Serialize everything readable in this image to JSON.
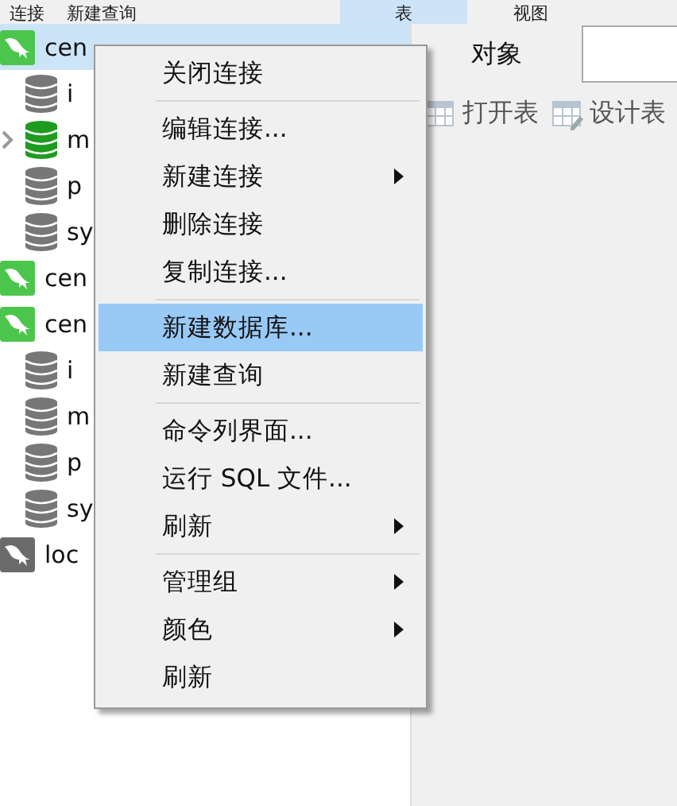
{
  "toolbar": [
    {
      "label": "连接"
    },
    {
      "label": "新建查询"
    }
  ],
  "view_tabs": [
    {
      "label": "表",
      "selected": true
    },
    {
      "label": "视图",
      "selected": false
    }
  ],
  "tree": [
    {
      "kind": "connection",
      "label": "cen",
      "selected": true,
      "active": true,
      "children": [
        {
          "kind": "database",
          "label": "i",
          "active": false,
          "expandable": false
        },
        {
          "kind": "database",
          "label": "m",
          "active": true,
          "expandable": true
        },
        {
          "kind": "database",
          "label": "p",
          "active": false,
          "expandable": false
        },
        {
          "kind": "database",
          "label": "sy",
          "active": false,
          "expandable": false
        }
      ]
    },
    {
      "kind": "connection",
      "label": "cen",
      "selected": false,
      "active": true
    },
    {
      "kind": "connection",
      "label": "cen",
      "selected": false,
      "active": true,
      "children": [
        {
          "kind": "database",
          "label": "i",
          "active": false,
          "expandable": false
        },
        {
          "kind": "database",
          "label": "m",
          "active": false,
          "expandable": false
        },
        {
          "kind": "database",
          "label": "p",
          "active": false,
          "expandable": false
        },
        {
          "kind": "database",
          "label": "sy",
          "active": false,
          "expandable": false
        }
      ]
    },
    {
      "kind": "connection",
      "label": "loc",
      "selected": false,
      "active": false
    }
  ],
  "object_tab": {
    "label": "对象"
  },
  "object_toolbar": [
    {
      "label": "打开表"
    },
    {
      "label": "设计表"
    }
  ],
  "context_menu": [
    {
      "kind": "item",
      "label": "关闭连接",
      "submenu": false,
      "selected": false
    },
    {
      "kind": "separator"
    },
    {
      "kind": "item",
      "label": "编辑连接...",
      "submenu": false,
      "selected": false
    },
    {
      "kind": "item",
      "label": "新建连接",
      "submenu": true,
      "selected": false
    },
    {
      "kind": "item",
      "label": "删除连接",
      "submenu": false,
      "selected": false
    },
    {
      "kind": "item",
      "label": "复制连接...",
      "submenu": false,
      "selected": false
    },
    {
      "kind": "separator"
    },
    {
      "kind": "item",
      "label": "新建数据库...",
      "submenu": false,
      "selected": true
    },
    {
      "kind": "item",
      "label": "新建查询",
      "submenu": false,
      "selected": false
    },
    {
      "kind": "separator"
    },
    {
      "kind": "item",
      "label": "命令列界面...",
      "submenu": false,
      "selected": false
    },
    {
      "kind": "item",
      "label": "运行 SQL 文件...",
      "submenu": false,
      "selected": false
    },
    {
      "kind": "item",
      "label": "刷新",
      "submenu": true,
      "selected": false
    },
    {
      "kind": "separator"
    },
    {
      "kind": "item",
      "label": "管理组",
      "submenu": true,
      "selected": false
    },
    {
      "kind": "item",
      "label": "颜色",
      "submenu": true,
      "selected": false
    },
    {
      "kind": "item",
      "label": "刷新",
      "submenu": false,
      "selected": false
    }
  ]
}
